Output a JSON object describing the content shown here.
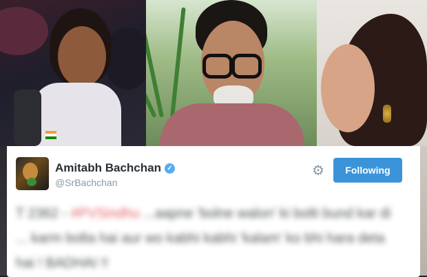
{
  "header_photo": {
    "description_icons": [
      "athlete-photo",
      "man-with-glasses-photo",
      "woman-photo"
    ]
  },
  "tweet": {
    "author_name": "Amitabh Bachchan",
    "verified_icon": "✓",
    "handle": "@SrBachchan",
    "follow_label": "Following",
    "settings_icon": "⚙",
    "text_prefix": "T 2362 - ",
    "hashtag": "#PVSindhu",
    "text_body": " ...aapne 'bolne walon' ki bolti bund kar di ... karm bolta hai aur wo kabhi kabhi 'kalam' ko bhi hara deta hai ! BADHAI !!"
  },
  "colors": {
    "follow_button": "#3b94d9",
    "verified": "#55acee",
    "hashtag": "#e0414a"
  }
}
